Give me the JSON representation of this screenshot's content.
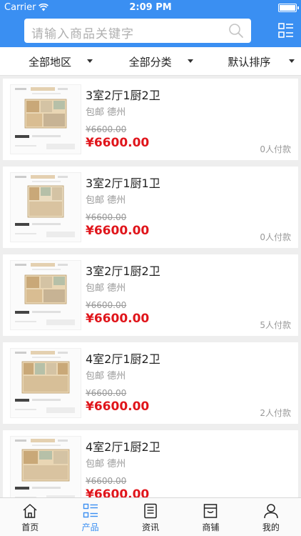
{
  "status_bar": {
    "carrier": "Carrier",
    "time": "2:09 PM"
  },
  "search": {
    "placeholder": "请输入商品关键字"
  },
  "filters": [
    {
      "label": "全部地区"
    },
    {
      "label": "全部分类"
    },
    {
      "label": "默认排序"
    }
  ],
  "products": [
    {
      "title": "3室2厅1厨2卫",
      "shipping": "包邮",
      "city": "德州",
      "original_price": "¥6600.00",
      "price": "¥6600.00",
      "paid": "0人付款"
    },
    {
      "title": "3室2厅1厨1卫",
      "shipping": "包邮",
      "city": "德州",
      "original_price": "¥6600.00",
      "price": "¥6600.00",
      "paid": "0人付款"
    },
    {
      "title": "3室2厅1厨2卫",
      "shipping": "包邮",
      "city": "德州",
      "original_price": "¥6600.00",
      "price": "¥6600.00",
      "paid": "5人付款"
    },
    {
      "title": "4室2厅1厨2卫",
      "shipping": "包邮",
      "city": "德州",
      "original_price": "¥6600.00",
      "price": "¥6600.00",
      "paid": "2人付款"
    },
    {
      "title": "4室2厅1厨2卫",
      "shipping": "包邮",
      "city": "德州",
      "original_price": "¥6600.00",
      "price": "¥6600.00",
      "paid": ""
    }
  ],
  "tabs": [
    {
      "label": "首页",
      "icon": "home-icon"
    },
    {
      "label": "产品",
      "icon": "product-list-icon",
      "active": true
    },
    {
      "label": "资讯",
      "icon": "news-icon"
    },
    {
      "label": "商铺",
      "icon": "shop-icon"
    },
    {
      "label": "我的",
      "icon": "profile-icon"
    }
  ],
  "colors": {
    "brand": "#3a8ff2",
    "price": "#e0151b",
    "muted": "#999999"
  }
}
